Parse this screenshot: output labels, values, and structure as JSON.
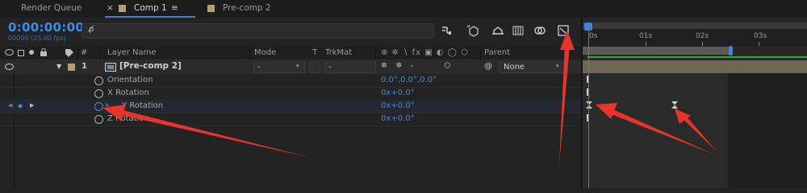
{
  "tabs": {
    "render_queue": "Render Queue",
    "close": "×",
    "comp1": "Comp 1",
    "menu": "≡",
    "precomp2": "Pre-comp 2"
  },
  "timeline": {
    "timecode": "0:00:00:00",
    "fps": "00000 (25.00 fps)",
    "search_icon": "ρ̸",
    "columns": {
      "num": "#",
      "layer_name": "Layer Name",
      "mode": "Mode",
      "t": "T",
      "trkmat": "TrkMat",
      "switches": "⊕ ✲ ∖ fx ▣ ◐ ◯ ⬡",
      "parent": "Parent"
    },
    "layer": {
      "index": "1",
      "name": "[Pre-comp 2]",
      "mode": "-",
      "trkmat": "-",
      "parent": "None"
    },
    "properties": [
      {
        "name": "Orientation",
        "value": "0.0°,0.0°,0.0°"
      },
      {
        "name": "X Rotation",
        "value": "0x+0.0°"
      },
      {
        "name": "Y Rotation",
        "value": "0x+0.0°"
      },
      {
        "name": "Z Rotation",
        "value": "0x+0.0°"
      }
    ],
    "ruler": [
      "0s",
      "01s",
      "02s",
      "03s"
    ]
  },
  "colors": {
    "accent": "#3c8ce7",
    "label": "#b79e73",
    "work_area": "#5a5a5a",
    "green_bar": "#2fae2f",
    "annotation": "#e8352c"
  }
}
